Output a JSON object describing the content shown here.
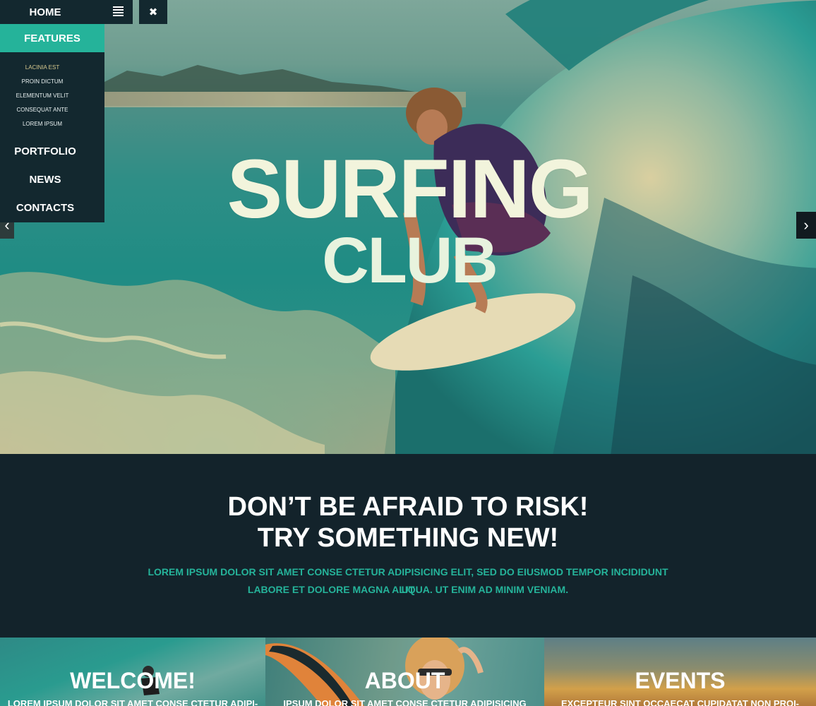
{
  "nav": {
    "home_label": "HOME",
    "close_icon": "✖",
    "features_label": "FEATURES",
    "sub_items": [
      "LACINIA EST",
      "PROIN DICTUM",
      "ELEMENTUM VELIT",
      "CONSEQUAT ANTE",
      "LOREM IPSUM"
    ],
    "portfolio_label": "PORTFOLIO",
    "news_label": "NEWS",
    "contacts_label": "CONTACTS",
    "accent": "#25b39a",
    "active_sub_color": "#d7c98e",
    "panel_color": "#13282f"
  },
  "hero": {
    "title_line1": "SURFING",
    "title_line2": "CLUB",
    "prev_icon": "‹",
    "next_icon": "›"
  },
  "tagline": {
    "heading_line1": "DON’T BE AFRAID TO RISK!",
    "heading_line2": "TRY SOMETHING NEW!",
    "text_line1": "LOREM IPSUM DOLOR SIT AMET CONSE CTETUR ADIPISICING ELIT, SED DO EIUSMOD TEMPOR INCIDIDUNT UT",
    "text_line2": "LABORE ET DOLORE MAGNA ALIQUA. UT ENIM AD MINIM VENIAM."
  },
  "cards": [
    {
      "title": "WELCOME!",
      "excerpt": "LOREM IPSUM DOLOR SIT AMET CONSE CTETUR ADIPI-"
    },
    {
      "title": "ABOUT",
      "excerpt": "IPSUM DOLOR SIT AMET CONSE CTETUR ADIPISICING"
    },
    {
      "title": "EVENTS",
      "excerpt": "EXCEPTEUR SINT OCCAECAT CUPIDATAT NON PROI-"
    }
  ]
}
